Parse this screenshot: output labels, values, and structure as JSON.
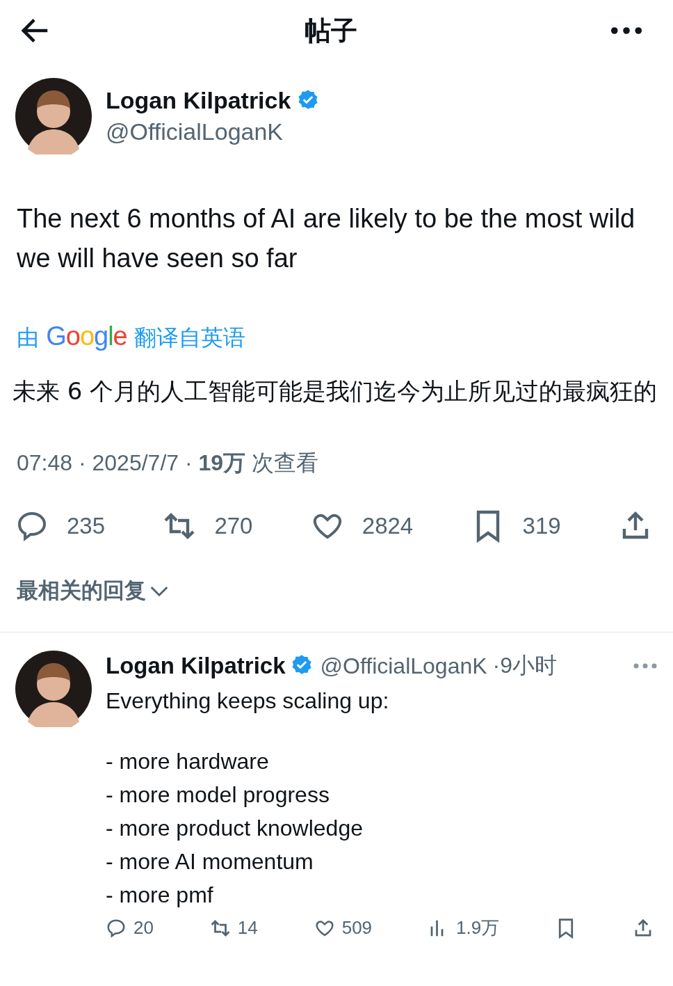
{
  "header": {
    "title": "帖子"
  },
  "post": {
    "author": {
      "name": "Logan Kilpatrick",
      "handle": "@OfficialLoganK",
      "verified": true
    },
    "text": "The next 6 months of AI are likely to be the most wild we will have seen so far",
    "translation": {
      "prefix": "由",
      "brand": "Google",
      "suffix": "翻译自英语"
    },
    "translated_text": "未来 6 个月的人工智能可能是我们迄今为止所见过的最疯狂的",
    "meta": "07:48 · 2025/7/7 · **19万** 次查看",
    "actions": [
      {
        "kind": "reply",
        "count": "235"
      },
      {
        "kind": "repost",
        "count": "270"
      },
      {
        "kind": "like",
        "count": "2824"
      },
      {
        "kind": "bookmark",
        "count": "319"
      },
      {
        "kind": "share"
      }
    ]
  },
  "sort": {
    "label": "最相关的回复"
  },
  "reply": {
    "author": {
      "name": "Logan Kilpatrick",
      "handle": "@OfficialLoganK",
      "verified": true
    },
    "time": "·9小时",
    "text": "Everything keeps scaling up:",
    "list": [
      "- more hardware",
      "- more model progress",
      "- more product knowledge",
      "- more AI momentum",
      "- more pmf"
    ],
    "actions": [
      {
        "kind": "reply",
        "count": "20"
      },
      {
        "kind": "repost",
        "count": "14"
      },
      {
        "kind": "like",
        "count": "509"
      },
      {
        "kind": "views",
        "count": "1.9万"
      },
      {
        "kind": "bookmark"
      },
      {
        "kind": "share"
      }
    ]
  }
}
